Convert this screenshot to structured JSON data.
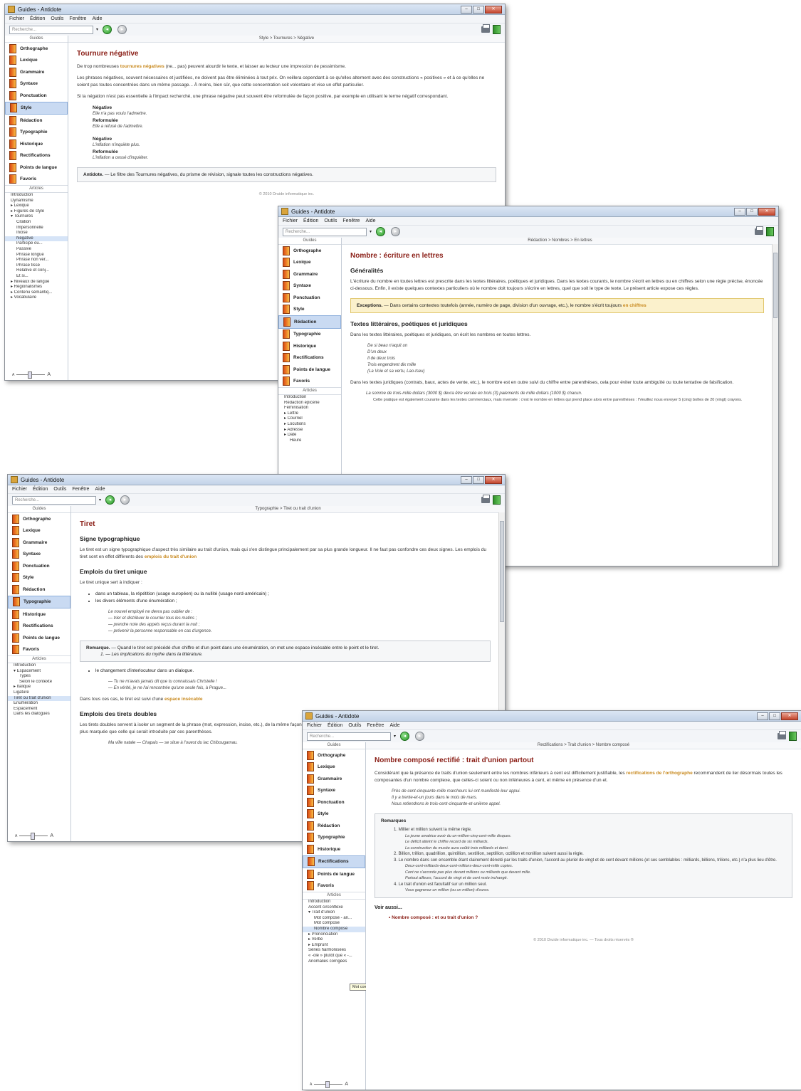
{
  "app": {
    "title": "Guides - Antidote",
    "menu": [
      "Fichier",
      "Édition",
      "Outils",
      "Fenêtre",
      "Aide"
    ],
    "search_placeholder": "Recherche...",
    "guides_header": "Guides",
    "articles_header": "Articles",
    "guides": [
      "Orthographe",
      "Lexique",
      "Grammaire",
      "Syntaxe",
      "Ponctuation",
      "Style",
      "Rédaction",
      "Typographie",
      "Historique",
      "Rectifications",
      "Points de langue",
      "Favoris"
    ],
    "zoom_small": "A",
    "zoom_large": "A"
  },
  "win1": {
    "breadcrumb": "Style > Tournures > Négative",
    "articles": [
      {
        "t": "Introduction",
        "l": 1
      },
      {
        "t": "Dynamisme",
        "l": 1
      },
      {
        "t": "▸ Lexique",
        "l": 1
      },
      {
        "t": "▸ Figures de style",
        "l": 1
      },
      {
        "t": "▾ Tournures",
        "l": 1
      },
      {
        "t": "Citation",
        "l": 2
      },
      {
        "t": "Impersonnelle",
        "l": 2
      },
      {
        "t": "Incise",
        "l": 2
      },
      {
        "t": "Négative",
        "l": 2,
        "sel": true
      },
      {
        "t": "Participe ou...",
        "l": 2
      },
      {
        "t": "Passive",
        "l": 2
      },
      {
        "t": "Phrase longue",
        "l": 2
      },
      {
        "t": "Phrase non ver...",
        "l": 2
      },
      {
        "t": "Phrase tissé",
        "l": 2
      },
      {
        "t": "Relative et conj...",
        "l": 2
      },
      {
        "t": "Et si...",
        "l": 2
      },
      {
        "t": "▸ Niveaux de langue",
        "l": 1
      },
      {
        "t": "▸ Régionalismes",
        "l": 1
      },
      {
        "t": "▸ Contenu sémantiq...",
        "l": 1
      },
      {
        "t": "▸ Vocabulaire",
        "l": 1
      }
    ],
    "title": "Tournure négative",
    "p1_a": "De trop nombreuses ",
    "p1_link": "tournures négatives",
    "p1_b": " (ne... pas) peuvent alourdir le texte, et laisser au lecteur une impression de pessimisme.",
    "p2": "Les phrases négatives, souvent nécessaires et justifiées, ne doivent pas être éliminées à tout prix. On veillera cependant à ce qu'elles alternent avec des constructions « positives » et à ce qu'elles ne soient pas toutes concentrées dans un même passage... À moins, bien sûr, que cette concentration soit volontaire et vise un effet particulier.",
    "p3": "Si la négation n'est pas essentielle à l'impact recherché, une phrase négative peut souvent être reformulée de façon positive, par exemple en utilisant le terme négatif correspondant.",
    "neg_label": "Négative",
    "ref_label": "Reformulée",
    "ex1_neg": "Elle n'a pas voulu l'admettre.",
    "ex1_ref": "Elle a refusé de l'admettre.",
    "ex2_neg": "L'inflation n'inquiète plus.",
    "ex2_ref": "L'inflation a cessé d'inquiéter.",
    "note_label": "Antidote.",
    "note": " — Le filtre des Tournures négatives, du prisme de révision, signale toutes les constructions négatives.",
    "footer": "© 2010 Druide informatique inc."
  },
  "win2": {
    "breadcrumb": "Rédaction > Nombres > En lettres",
    "articles": [
      {
        "t": "Introduction",
        "l": 1
      },
      {
        "t": "Rédaction épicène",
        "l": 1
      },
      {
        "t": "Féminisation",
        "l": 1
      },
      {
        "t": "▸ Lettre",
        "l": 1
      },
      {
        "t": "▸ Courriel",
        "l": 1
      },
      {
        "t": "▸ Locutions",
        "l": 1
      },
      {
        "t": "▸ Adresse",
        "l": 1
      },
      {
        "t": "▸ Date",
        "l": 1
      },
      {
        "t": "Heure",
        "l": 2
      }
    ],
    "title": "Nombre : écriture en lettres",
    "h2a": "Généralités",
    "p1": "L'écriture du nombre en toutes lettres est prescrite dans les textes littéraires, poétiques et juridiques. Dans les textes courants, le nombre s'écrit en lettres ou en chiffres selon une règle précise, énoncée ci-dessous. Enfin, il existe quelques contextes particuliers où le nombre doit toujours s'écrire en lettres, quel que soit le type de texte. Le présent article expose ces règles.",
    "exc_label": "Exceptions.",
    "exc": " — Dans certains contextes toutefois (année, numéro de page, division d'un ouvrage, etc.), le nombre s'écrit toujours ",
    "exc_link": "en chiffres",
    "h2b": "Textes littéraires, poétiques et juridiques",
    "p2": "Dans les textes littéraires, poétiques et juridiques, on écrit les nombres en toutes lettres.",
    "ex": [
      "De si beau n'aquit un",
      "D'un deux",
      "Il de deux trois",
      "Trois engendrent dix mille",
      "(La Voie et sa vertu, Lao-tseu)"
    ],
    "p3": "Dans les textes juridiques (contrats, baux, actes de vente, etc.), le nombre est en outre suivi du chiffre entre parenthèses, cela pour éviter toute ambiguïté ou toute tentative de falsification.",
    "ex2": "La somme de trois-mille dollars (3000 $) devra être versée en trois (3) paiements de mille dollars (1000 $) chacun.",
    "ex2_note": "Cette pratique est également courante dans les textes commerciaux, mais inversée : c'est le nombre en lettres qui prend place alors entre parenthèses : l'Veuillez nous envoyer 5 (cinq) boîtes de 20 (vingt) crayons."
  },
  "win3": {
    "breadcrumb": "Typographie > Tiret ou trait d'union",
    "articles": [
      {
        "t": "Introduction",
        "l": 1
      },
      {
        "t": "▾ Espacement",
        "l": 1
      },
      {
        "t": "Types",
        "l": 2
      },
      {
        "t": "Selon le contexte",
        "l": 2
      },
      {
        "t": "▸ Italique",
        "l": 1
      },
      {
        "t": "Ligature",
        "l": 1
      },
      {
        "t": "Tiret ou trait d'union",
        "l": 1,
        "sel": true
      },
      {
        "t": "Énumération",
        "l": 1
      },
      {
        "t": "Espacement",
        "l": 1
      },
      {
        "t": "Dans les dialogues",
        "l": 1
      }
    ],
    "title": "Tiret",
    "h2a": "Signe typographique",
    "p1_a": "Le tiret est un signe typographique d'aspect très similaire au trait d'union, mais qui s'en distingue principalement par sa plus grande longueur. Il ne faut pas confondre ces deux signes. Les emplois du tiret sont en effet différents des ",
    "p1_link": "emplois du trait d'union",
    "h2b": "Emplois du tiret unique",
    "p2": "Le tiret unique sert à indiquer :",
    "bullets": [
      "dans un tableau, la répétition (usage européen) ou la nullité (usage nord-américain) ;",
      "les divers éléments d'une énumération ;"
    ],
    "ex": [
      "Le nouvel employé ne devra pas oublier de :",
      "— trier et distribuer le courrier tous les matins ;",
      "— prendre note des appels reçus durant la nuit ;",
      "— prévenir la personne responsable en cas d'urgence."
    ],
    "rem_label": "Remarque.",
    "rem": " — Quand le tiret est précédé d'un chiffre et d'un point dans une énumération, on met une espace insécable entre le point et le tiret.",
    "rem_ex": "1. — Les implications du mythe dans la littérature.",
    "bullet3": "le changement d'interlocuteur dans un dialogue.",
    "ex3": [
      "— Tu ne m'avais jamais dit que tu connaissais Christelle !",
      "— En vérité, je ne l'ai rencontrée qu'une seule fois, à Prague..."
    ],
    "p3_a": "Dans tous ces cas, le tiret est suivi d'une ",
    "p3_link": "espace insécable",
    "h2c": "Emplois des tirets doubles",
    "p4": "Les tirets doubles servent à isoler un segment de la phrase (mot, expression, incise, etc.), de la même façon que les parenthèses ou les virgules, cependant que la coupure introduite par les tirets est plus marquée que celle qui serait introduite par ces parenthèses.",
    "ex4": "Ma ville natale — Chapais — se situe à l'ouest du lac Chibougamau."
  },
  "win4": {
    "breadcrumb": "Rectifications > Trait d'union > Nombre composé",
    "articles": [
      {
        "t": "Introduction",
        "l": 1
      },
      {
        "t": "Accent circonflexe",
        "l": 1
      },
      {
        "t": "▾ Trait d'union",
        "l": 1
      },
      {
        "t": "Mot composé - an...",
        "l": 2
      },
      {
        "t": "Mot composé",
        "l": 2
      },
      {
        "t": "Nombre composé",
        "l": 2,
        "sel": true
      },
      {
        "t": "▸ Prononciation",
        "l": 1
      },
      {
        "t": "▸ Verbe",
        "l": 1
      },
      {
        "t": "▸ Emprunt",
        "l": 1
      },
      {
        "t": "Séries harmonisées",
        "l": 1
      },
      {
        "t": "« -ole » plutôt que « -...",
        "l": 1
      },
      {
        "t": "Anomalies corrigées",
        "l": 1
      }
    ],
    "tooltip": "Mot composé - cinq, et plus",
    "title": "Nombre composé rectifié : trait d'union partout",
    "p1_a": "Considérant que la présence de traits d'union seulement entre les nombres inférieurs à cent est difficilement justifiable, les ",
    "p1_link": "rectifications de l'orthographe",
    "p1_b": " recommandent de lier désormais toutes les composantes d'un nombre complexe, que celles-ci soient ou non inférieures à cent, et même en présence d'un et.",
    "ex": [
      "Près de cent-cinquante-mille marcheurs lui ont manifesté leur appui.",
      "Il y a trente-et-un jours dans le mois de mars.",
      "Nous retiendrons le trois-cent-cinquante-et-unième appel."
    ],
    "rem_title": "Remarques",
    "rem": [
      "1. Millier et million suivent la même règle.",
      "La jeune amatrice avoir du un-million-cinq-cent-mille disques.",
      "Le déficit atteint le chiffre record de six milliards.",
      "La construction du musée aura coûté trois milliards et demi.",
      "2. Billion, trillion, quadrillion, quintillion, sextillion, septillion, octillion et nonillion suivent aussi la règle.",
      "3. Le nombre dans son ensemble étant clairement dénoté par les traits d'union, l'accord au pluriel de vingt et de cent devant millions (et ses semblables : milliards, billions, trilions, etc.) n'a plus lieu d'être.",
      "Deux-cent-milliards-deux-cent-millions-deux-cent-mille copies.",
      "Cent ne s'accorde pas plus devant millions ou milliards que devant mille.",
      "Partout ailleurs, l'accord de vingt et de cent reste inchangé.",
      "4. Le trait d'union est facultatif sur un million seul.",
      "Vous gagnerez un million (ou un million) d'euros."
    ],
    "seealso_title": "Voir aussi...",
    "seealso_item": "Nombre composé : et ou trait d'union ?",
    "footer": "© 2010 Druide informatique inc. — Tous droits réservés ®"
  }
}
